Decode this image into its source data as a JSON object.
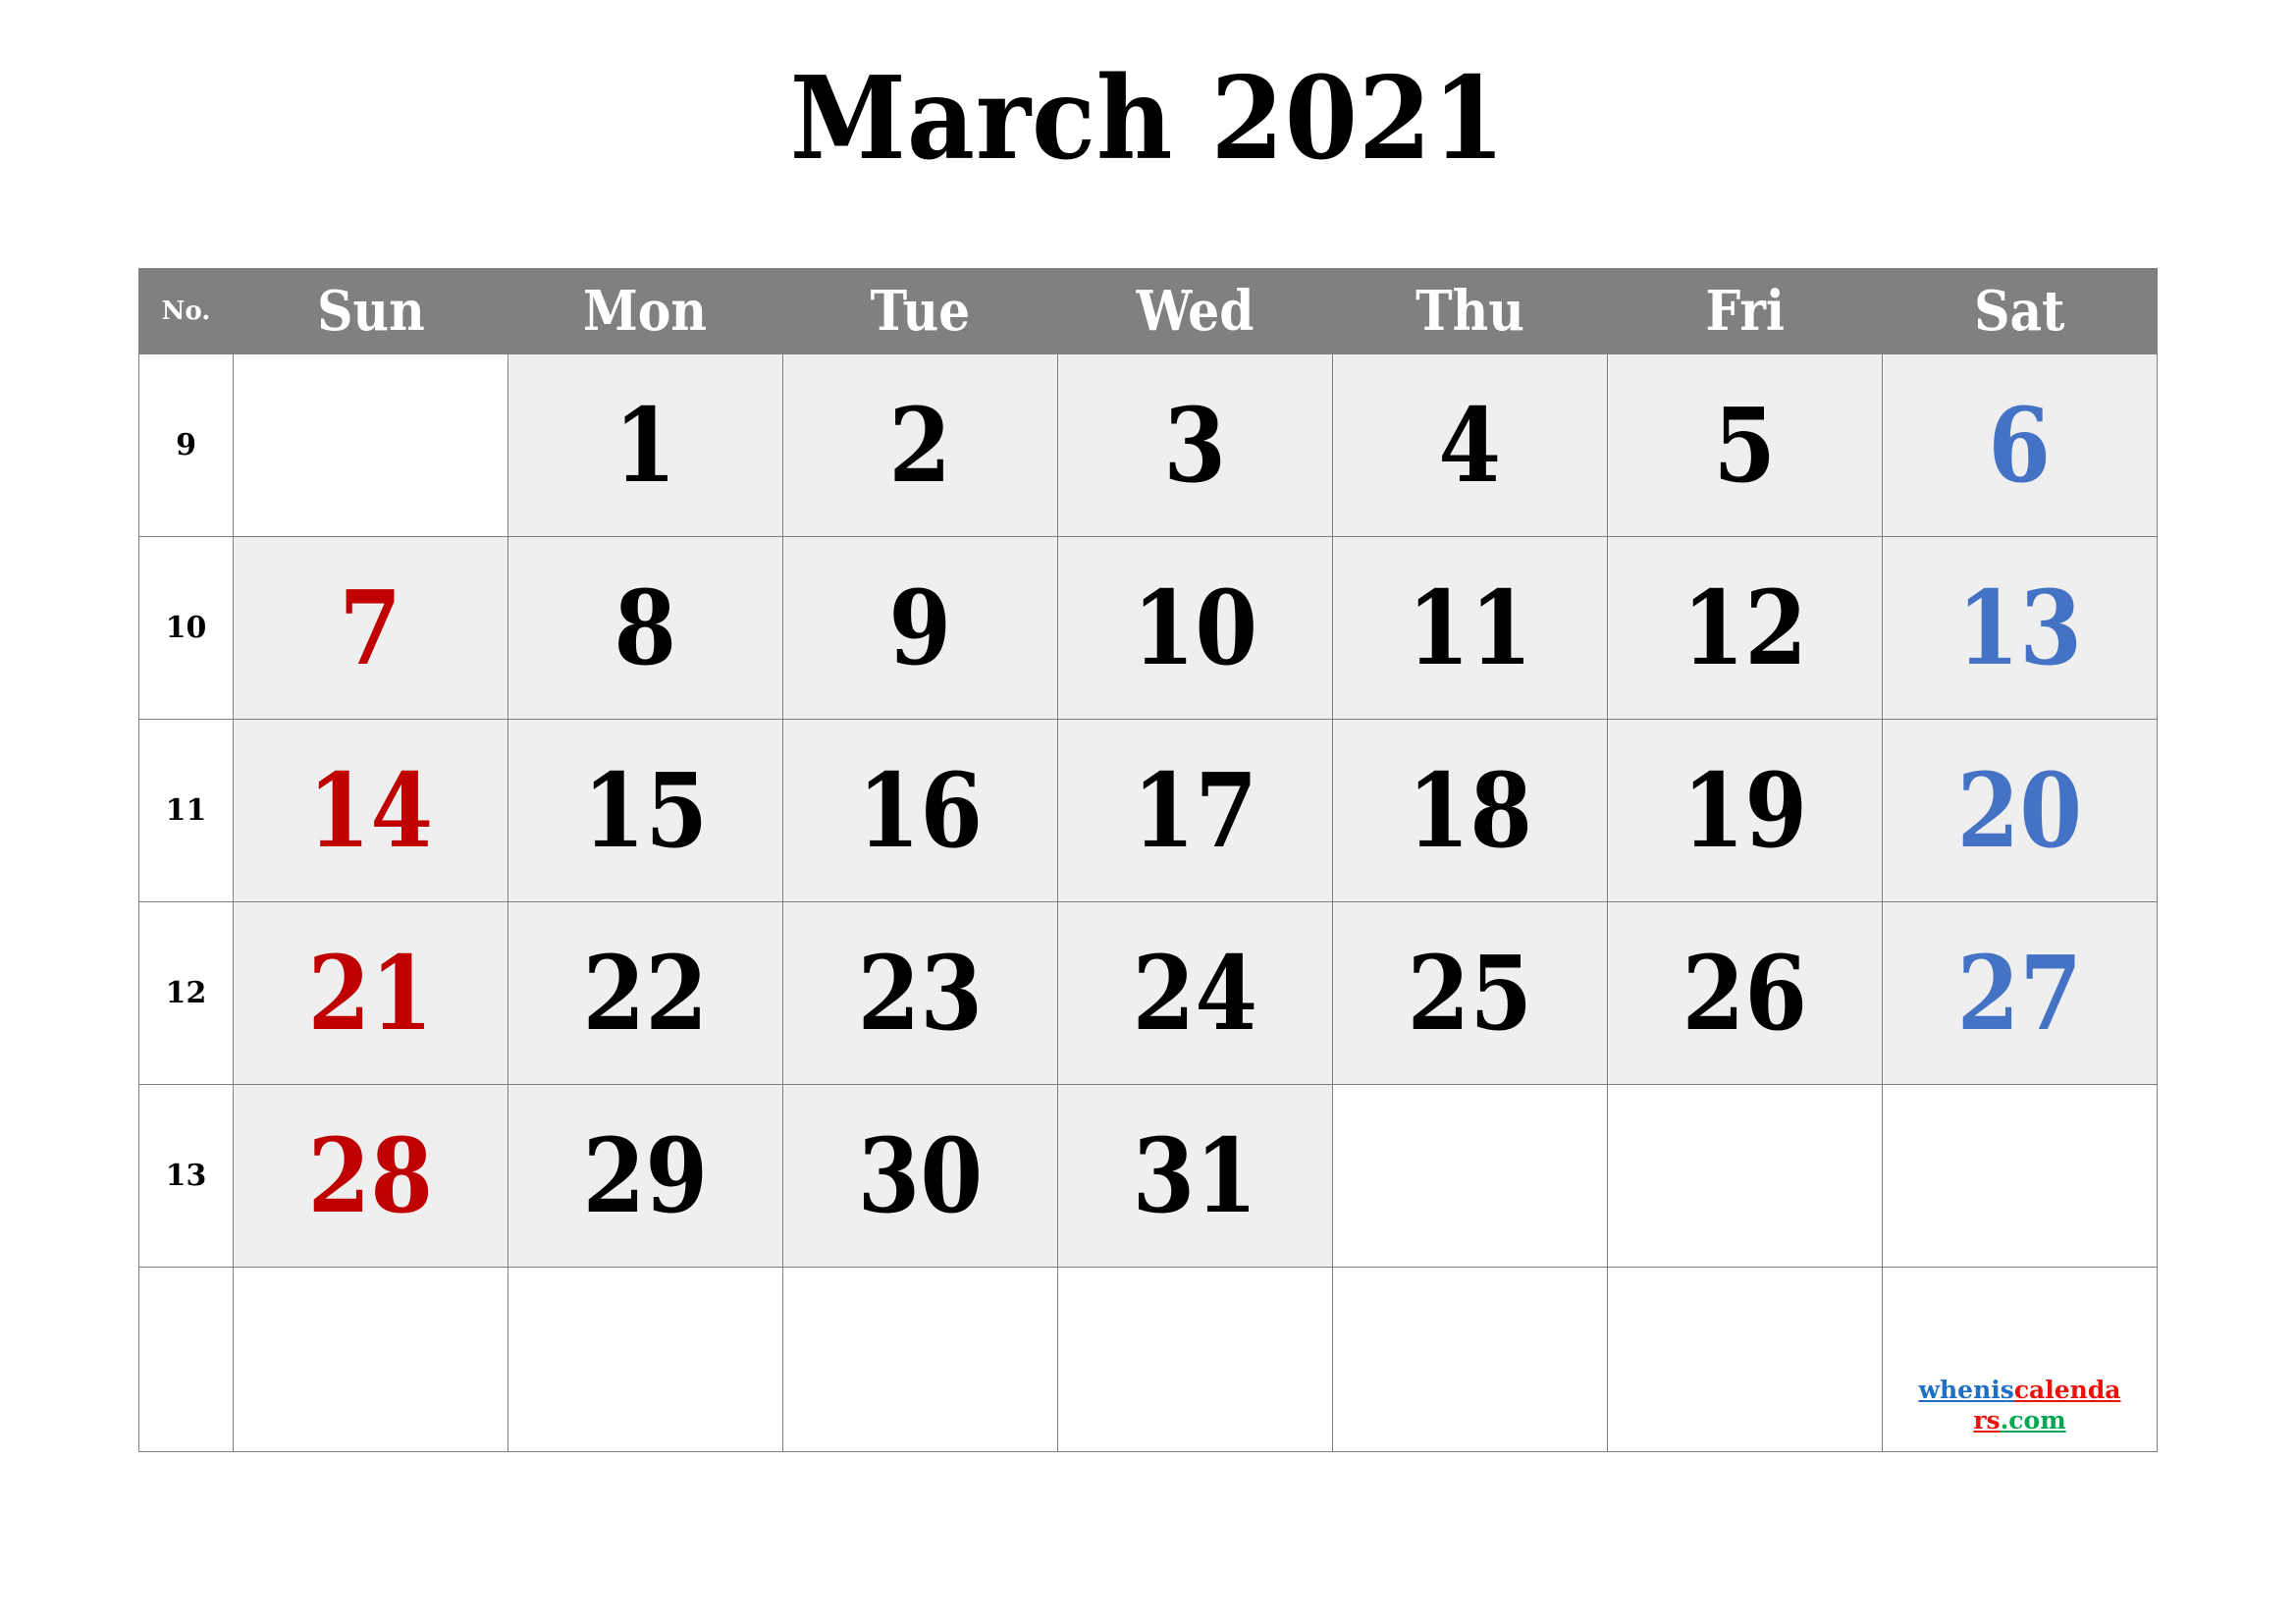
{
  "title": "March 2021",
  "colors": {
    "header_bg": "#808080",
    "header_text": "#ffffff",
    "grid_line": "#7f7f7f",
    "cell_filled": "#efefef",
    "cell_empty": "#ffffff",
    "sunday": "#c00000",
    "saturday": "#4472c4",
    "weekday": "#000000",
    "watermark_blue": "#1f6fc4",
    "watermark_red": "#e8140c",
    "watermark_green": "#00a651"
  },
  "header": {
    "no_label": "No.",
    "days": [
      "Sun",
      "Mon",
      "Tue",
      "Wed",
      "Thu",
      "Fri",
      "Sat"
    ]
  },
  "weeks": [
    {
      "no": "9",
      "days": [
        "",
        "1",
        "2",
        "3",
        "4",
        "5",
        "6"
      ]
    },
    {
      "no": "10",
      "days": [
        "7",
        "8",
        "9",
        "10",
        "11",
        "12",
        "13"
      ]
    },
    {
      "no": "11",
      "days": [
        "14",
        "15",
        "16",
        "17",
        "18",
        "19",
        "20"
      ]
    },
    {
      "no": "12",
      "days": [
        "21",
        "22",
        "23",
        "24",
        "25",
        "26",
        "27"
      ]
    },
    {
      "no": "13",
      "days": [
        "28",
        "29",
        "30",
        "31",
        "",
        "",
        ""
      ]
    },
    {
      "no": "",
      "days": [
        "",
        "",
        "",
        "",
        "",
        "",
        ""
      ]
    }
  ],
  "watermark": {
    "part1": "whenis",
    "part2": "calendars",
    "part3": ".com",
    "full": "wheniscalendars.com"
  }
}
